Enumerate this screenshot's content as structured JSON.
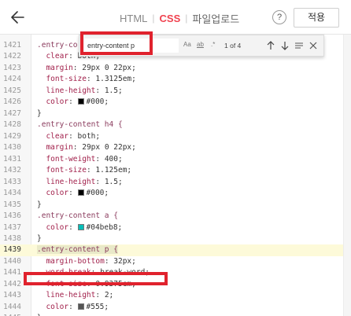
{
  "topbar": {
    "tabs": [
      {
        "label": "HTML"
      },
      {
        "label": "CSS"
      }
    ],
    "upload_label": "파일업로드",
    "help_label": "?",
    "apply_label": "적용"
  },
  "search": {
    "query": "entry-content p",
    "opt_case": "Aa",
    "opt_word": "ab",
    "opt_regex": ".*",
    "match_count": "1 of 4"
  },
  "colors": {
    "accent": "#f0424f",
    "annotation": "#e0222d",
    "swatch_black": "#000",
    "swatch_teal": "#04beb8",
    "swatch_gray": "#555"
  },
  "lines": [
    {
      "n": "1421",
      "sel": ".entry-co"
    },
    {
      "n": "1422",
      "prop": "clear",
      "val": "both;"
    },
    {
      "n": "1423",
      "prop": "margin",
      "val": "29px 0 22px;"
    },
    {
      "n": "1424",
      "prop": "font-size",
      "val": "1.3125em;"
    },
    {
      "n": "1425",
      "prop": "line-height",
      "val": "1.5;"
    },
    {
      "n": "1426",
      "prop": "color",
      "val": "#000;",
      "swatch": "#000"
    },
    {
      "n": "1427",
      "close": "}"
    },
    {
      "n": "1428",
      "sel": ".entry-content h4 {"
    },
    {
      "n": "1429",
      "prop": "clear",
      "val": "both;"
    },
    {
      "n": "1430",
      "prop": "margin",
      "val": "29px 0 22px;"
    },
    {
      "n": "1431",
      "prop": "font-weight",
      "val": "400;"
    },
    {
      "n": "1432",
      "prop": "font-size",
      "val": "1.125em;"
    },
    {
      "n": "1433",
      "prop": "line-height",
      "val": "1.5;"
    },
    {
      "n": "1434",
      "prop": "color",
      "val": "#000;",
      "swatch": "#000"
    },
    {
      "n": "1435",
      "close": "}"
    },
    {
      "n": "1436",
      "sel": ".entry-content a {"
    },
    {
      "n": "1437",
      "prop": "color",
      "val": "#04beb8;",
      "swatch": "#04beb8"
    },
    {
      "n": "1438",
      "close": "}"
    },
    {
      "n": "1439",
      "sel": ".entry-content p {",
      "active": true
    },
    {
      "n": "1440",
      "prop": "margin-bottom",
      "val": "32px;"
    },
    {
      "n": "1441",
      "prop": "word-break",
      "val": "break-word;"
    },
    {
      "n": "1442",
      "prop": "font-size",
      "val": "0.9375em;"
    },
    {
      "n": "1443",
      "prop": "line-height",
      "val": "2;"
    },
    {
      "n": "1444",
      "prop": "color",
      "val": "#555;",
      "swatch": "#555"
    },
    {
      "n": "1445",
      "close": "}"
    }
  ]
}
